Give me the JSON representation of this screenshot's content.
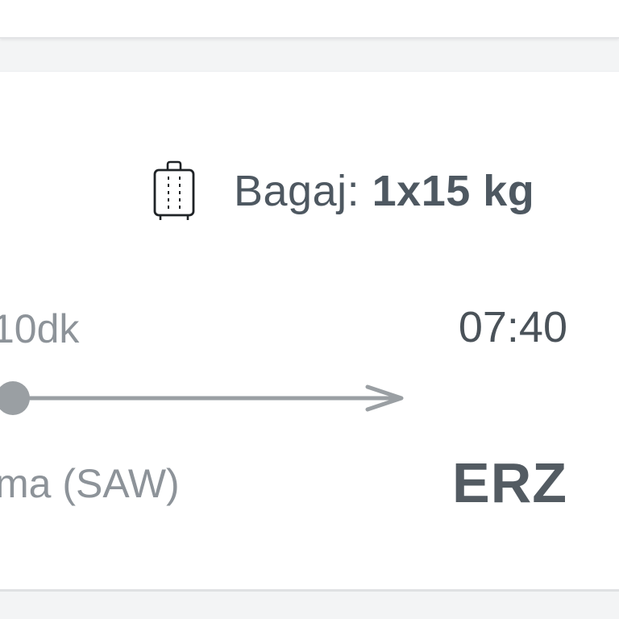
{
  "baggage": {
    "label": "Bagaj:",
    "value": "1x15 kg",
    "icon": "suitcase-icon"
  },
  "flight": {
    "duration": "10dk",
    "arrival_time": "07:40",
    "departure_airport": "ma (SAW)",
    "arrival_code": "ERZ"
  },
  "colors": {
    "card_background": "#ffffff",
    "page_background": "#f3f4f5",
    "text_dark": "#4e5861",
    "text_muted": "#8d9399",
    "route_line": "#9a9fa3"
  }
}
